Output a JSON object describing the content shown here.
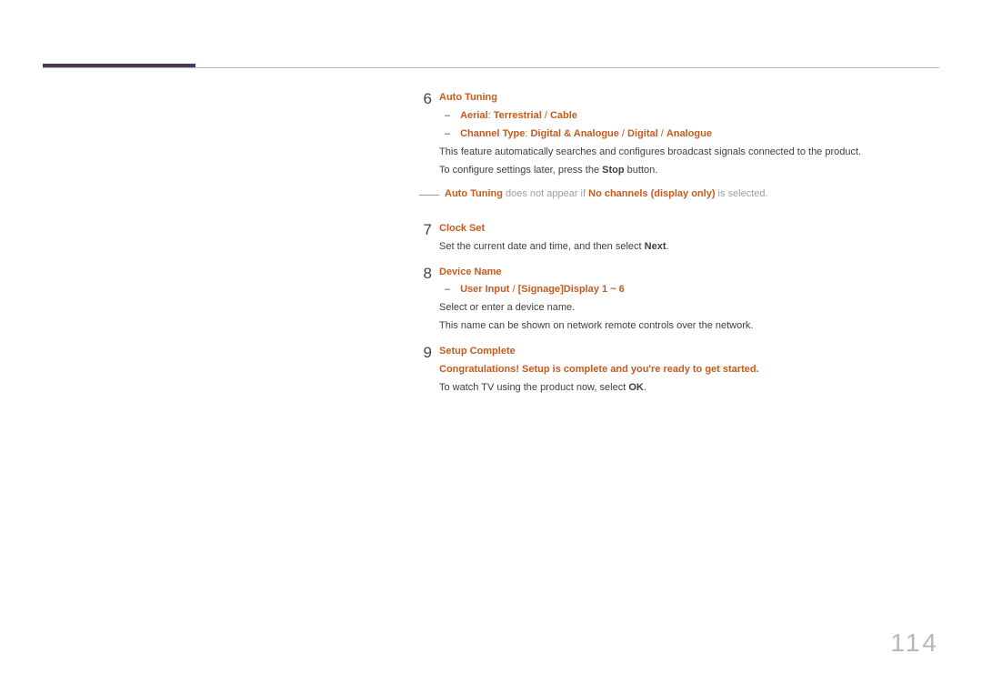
{
  "page_number": "114",
  "steps": {
    "s6": {
      "num": "6",
      "title": "Auto Tuning",
      "bul1_label": "Aerial",
      "bul1_sep": ": ",
      "bul1_opt1": "Terrestrial",
      "bul1_slash": " / ",
      "bul1_opt2": "Cable",
      "bul2_label": "Channel Type",
      "bul2_sep": ": ",
      "bul2_opt1": "Digital & Analogue",
      "bul2_slash1": " / ",
      "bul2_opt2": "Digital",
      "bul2_slash2": " / ",
      "bul2_opt3": "Analogue",
      "desc": "This feature automatically searches and configures broadcast signals connected to the product.",
      "desc2a": "To configure settings later, press the ",
      "desc2b": "Stop",
      "desc2c": " button.",
      "note_a": "Auto Tuning",
      "note_b": " does not appear if ",
      "note_c": "No channels (display only)",
      "note_d": " is selected."
    },
    "s7": {
      "num": "7",
      "title": "Clock Set",
      "desc_a": "Set the current date and time, and then select ",
      "desc_b": "Next",
      "desc_c": "."
    },
    "s8": {
      "num": "8",
      "title": "Device Name",
      "bul_opt1": "User Input",
      "bul_slash": " / ",
      "bul_opt2": "[Signage]Display 1 ~ 6",
      "desc1": "Select or enter a device name.",
      "desc2": "This name can be shown on network remote controls over the network."
    },
    "s9": {
      "num": "9",
      "title": "Setup Complete",
      "congrats": "Congratulations! Setup is complete and you're ready to get started.",
      "desc_a": "To watch TV using the product now, select ",
      "desc_b": "OK",
      "desc_c": "."
    }
  }
}
